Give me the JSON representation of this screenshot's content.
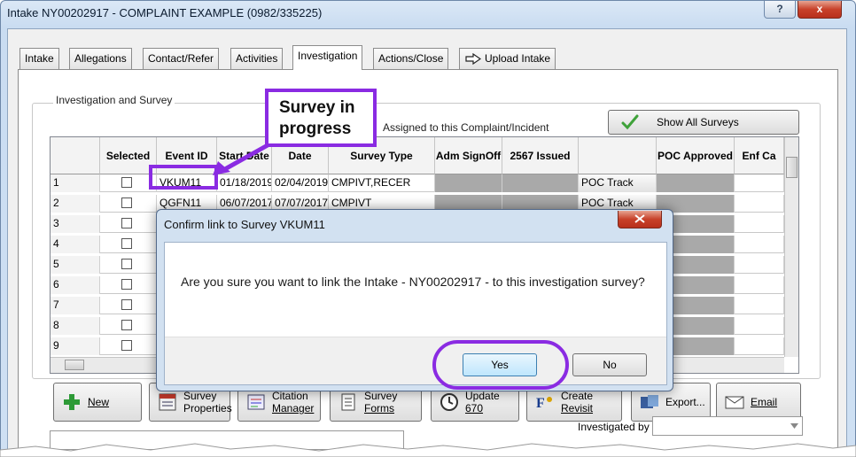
{
  "window": {
    "title": "Intake NY00202917 - COMPLAINT EXAMPLE (0982/335225)",
    "help": "?",
    "close": "x"
  },
  "tabs": [
    {
      "label": "Intake",
      "active": false
    },
    {
      "label": "Allegations",
      "active": false
    },
    {
      "label": "Contact/Refer",
      "active": false
    },
    {
      "label": "Activities",
      "active": false
    },
    {
      "label": "Investigation",
      "active": true
    },
    {
      "label": "Actions/Close",
      "active": false
    },
    {
      "label": "Upload Intake",
      "active": false
    }
  ],
  "group": {
    "label": "Investigation and Survey",
    "assigned_text": "Assigned to this Complaint/Incident",
    "show_all": "Show All Surveys"
  },
  "grid": {
    "headers": {
      "selected": "Selected",
      "event_id": "Event ID",
      "start_date": "Start Date",
      "exit_date": "Date",
      "survey_type": "Survey Type",
      "adm_signoff": "Adm SignOff",
      "issued_2567": "2567 Issued",
      "poc_approved": "POC Approved",
      "enf": "Enf Ca"
    },
    "rows": [
      {
        "num": "1",
        "event": "VKUM11",
        "start": "01/18/2019",
        "exit": "02/04/2019",
        "type": "CMPIVT,RECER",
        "poc": "POC Track"
      },
      {
        "num": "2",
        "event": "QGFN11",
        "start": "06/07/2017",
        "exit": "07/07/2017",
        "type": "CMPIVT",
        "poc": "POC Track"
      },
      {
        "num": "3"
      },
      {
        "num": "4"
      },
      {
        "num": "5"
      },
      {
        "num": "6"
      },
      {
        "num": "7"
      },
      {
        "num": "8"
      },
      {
        "num": "9"
      }
    ]
  },
  "toolbar": {
    "new": "New",
    "survey_properties": [
      "Survey",
      "Properties"
    ],
    "citation_manager": [
      "Citation",
      "Manager"
    ],
    "survey_forms": [
      "Survey",
      "Forms"
    ],
    "update_670": [
      "Update",
      "670"
    ],
    "create_revisit": [
      "Create",
      "Revisit"
    ],
    "export": "Export...",
    "email": "Email"
  },
  "investigated_by": "Investigated by",
  "dialog": {
    "title": "Confirm link to Survey VKUM11",
    "message": "Are you sure you want to link the Intake - NY00202917 - to this investigation survey?",
    "yes": "Yes",
    "no": "No"
  },
  "annotation": {
    "callout": "Survey in progress"
  },
  "colors": {
    "highlight": "#8a2be2",
    "grid_gray": "#a9a9a9"
  }
}
